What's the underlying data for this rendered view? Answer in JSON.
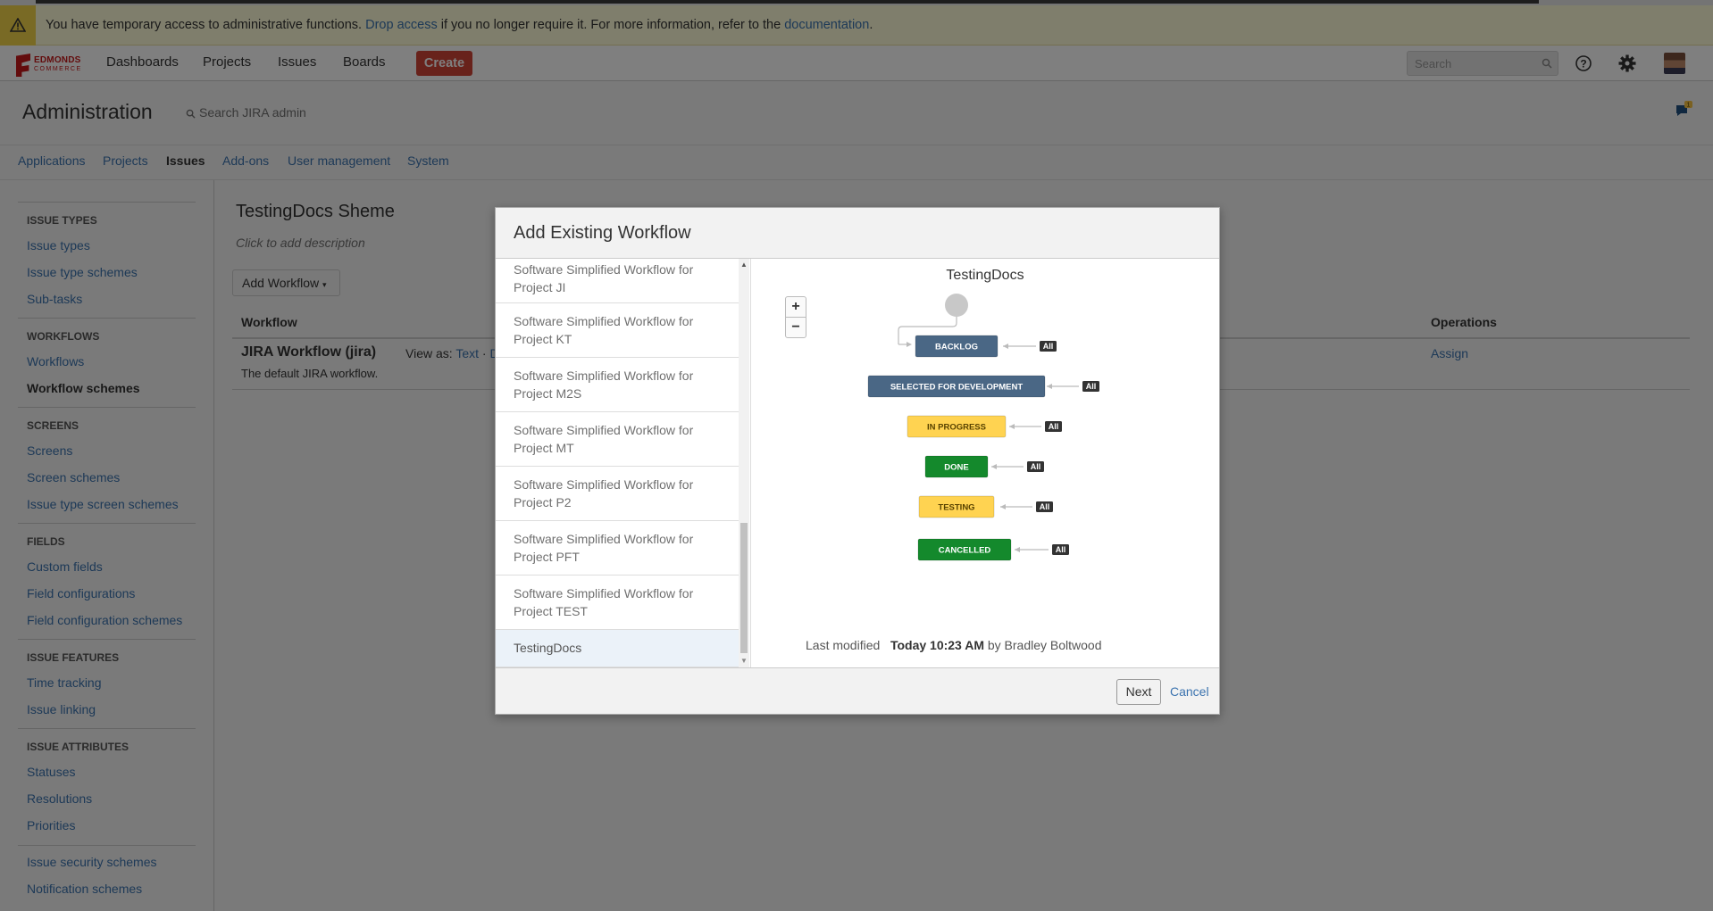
{
  "banner": {
    "text_before": "You have temporary access to administrative functions.",
    "drop_link": "Drop access",
    "text_middle": "if you no longer require it. For more information, refer to the",
    "doc_link": "documentation",
    "text_end": "."
  },
  "logo": {
    "line1": "EDMONDS",
    "line2": "COMMERCE"
  },
  "nav": {
    "dashboards": "Dashboards",
    "projects": "Projects",
    "issues": "Issues",
    "boards": "Boards",
    "create": "Create",
    "search_placeholder": "Search"
  },
  "admin": {
    "title": "Administration",
    "search_placeholder": "Search JIRA admin",
    "notification_count": "1"
  },
  "tabs": [
    "Applications",
    "Projects",
    "Issues",
    "Add-ons",
    "User management",
    "System"
  ],
  "sidebar": {
    "issue_types_head": "Issue Types",
    "issue_types": "Issue types",
    "issue_type_schemes": "Issue type schemes",
    "sub_tasks": "Sub-tasks",
    "workflows_head": "Workflows",
    "workflows": "Workflows",
    "workflow_schemes": "Workflow schemes",
    "screens_head": "Screens",
    "screens": "Screens",
    "screen_schemes": "Screen schemes",
    "issue_type_screen_schemes": "Issue type screen schemes",
    "fields_head": "Fields",
    "custom_fields": "Custom fields",
    "field_configurations": "Field configurations",
    "field_configuration_schemes": "Field configuration schemes",
    "issue_features_head": "Issue Features",
    "time_tracking": "Time tracking",
    "issue_linking": "Issue linking",
    "issue_attributes_head": "Issue Attributes",
    "statuses": "Statuses",
    "resolutions": "Resolutions",
    "priorities": "Priorities",
    "issue_security_schemes": "Issue security schemes",
    "notification_schemes": "Notification schemes"
  },
  "main": {
    "scheme_title": "TestingDocs Sheme",
    "scheme_desc": "Click to add description",
    "add_workflow": "Add Workflow",
    "col_workflow": "Workflow",
    "col_operations": "Operations",
    "wf_name": "JIRA Workflow (jira)",
    "view_as": "View as:",
    "view_text": "Text",
    "view_sep": "·",
    "view_diagram": "Dia",
    "wf_desc": "The default JIRA workflow.",
    "assign": "Assign"
  },
  "dialog": {
    "title": "Add Existing Workflow",
    "list": [
      {
        "line1": "Software Simplified Workflow for",
        "line2": "Project JI"
      },
      {
        "line1": "Software Simplified Workflow for",
        "line2": "Project KT"
      },
      {
        "line1": "Software Simplified Workflow for",
        "line2": "Project M2S"
      },
      {
        "line1": "Software Simplified Workflow for",
        "line2": "Project MT"
      },
      {
        "line1": "Software Simplified Workflow for",
        "line2": "Project P2"
      },
      {
        "line1": "Software Simplified Workflow for",
        "line2": "Project PFT"
      },
      {
        "line1": "Software Simplified Workflow for",
        "line2": "Project TEST"
      },
      {
        "line1": "TestingDocs",
        "line2": ""
      }
    ],
    "preview_title": "TestingDocs",
    "zoom_in": "+",
    "zoom_out": "−",
    "statuses": [
      {
        "label": "BACKLOG",
        "color": "#4a6785",
        "text_color": "#ffffff"
      },
      {
        "label": "SELECTED FOR DEVELOPMENT",
        "color": "#4a6785",
        "text_color": "#ffffff"
      },
      {
        "label": "IN PROGRESS",
        "color": "#ffd351",
        "text_color": "#594300"
      },
      {
        "label": "DONE",
        "color": "#14892c",
        "text_color": "#ffffff"
      },
      {
        "label": "TESTING",
        "color": "#ffd351",
        "text_color": "#594300"
      },
      {
        "label": "CANCELLED",
        "color": "#14892c",
        "text_color": "#ffffff"
      }
    ],
    "all_badge": "All",
    "modified_label": "Last modified",
    "modified_time": "Today 10:23 AM",
    "modified_by": "by Bradley Boltwood",
    "next": "Next",
    "cancel": "Cancel"
  }
}
